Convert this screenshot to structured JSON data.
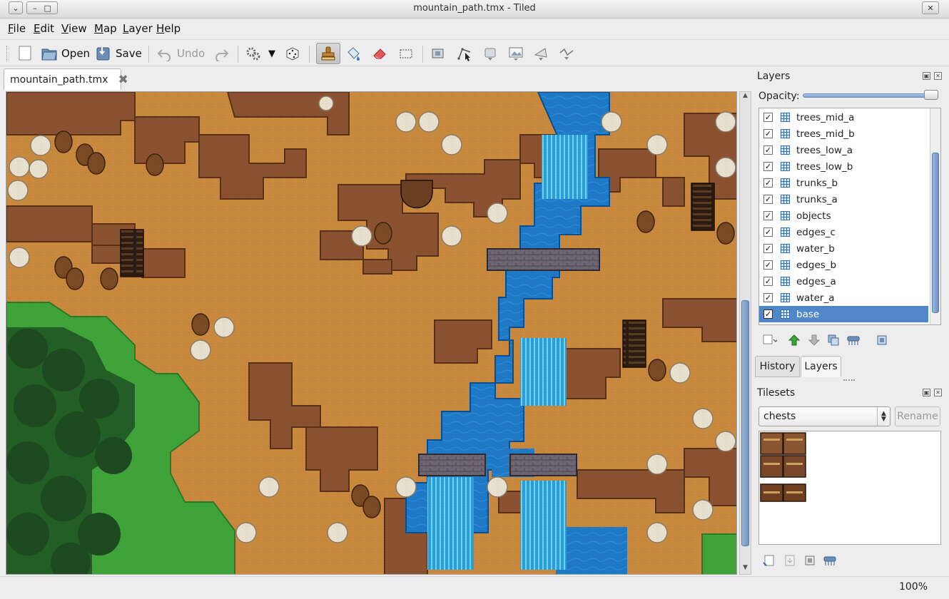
{
  "window": {
    "title": "mountain_path.tmx - Tiled",
    "menu_icon": "chevron-down-icon",
    "minimize_icon": "minimize-icon",
    "maximize_icon": "maximize-icon",
    "close_icon": "close-icon"
  },
  "menu": [
    {
      "key": "F",
      "rest": "ile"
    },
    {
      "key": "E",
      "rest": "dit"
    },
    {
      "key": "V",
      "rest": "iew"
    },
    {
      "key": "M",
      "rest": "ap"
    },
    {
      "key": "L",
      "rest": "ayer"
    },
    {
      "key": "H",
      "rest": "elp"
    }
  ],
  "toolbar": {
    "open_label": "Open",
    "save_label": "Save",
    "undo_label": "Undo"
  },
  "document_tab": {
    "label": "mountain_path.tmx",
    "close_icon": "close-icon"
  },
  "layers_panel": {
    "title": "Layers",
    "opacity_label": "Opacity:",
    "opacity": 1.0,
    "layers": [
      {
        "name": "trees_mid_a",
        "visible": true,
        "selected": false
      },
      {
        "name": "trees_mid_b",
        "visible": true,
        "selected": false
      },
      {
        "name": "trees_low_a",
        "visible": true,
        "selected": false
      },
      {
        "name": "trees_low_b",
        "visible": true,
        "selected": false
      },
      {
        "name": "trunks_b",
        "visible": true,
        "selected": false
      },
      {
        "name": "trunks_a",
        "visible": true,
        "selected": false
      },
      {
        "name": "objects",
        "visible": true,
        "selected": false
      },
      {
        "name": "edges_c",
        "visible": true,
        "selected": false
      },
      {
        "name": "water_b",
        "visible": true,
        "selected": false
      },
      {
        "name": "edges_b",
        "visible": true,
        "selected": false
      },
      {
        "name": "edges_a",
        "visible": true,
        "selected": false
      },
      {
        "name": "water_a",
        "visible": true,
        "selected": false
      },
      {
        "name": "base",
        "visible": true,
        "selected": true
      }
    ]
  },
  "panel_tabs": {
    "history_label": "History",
    "layers_label": "Layers",
    "active": "Layers"
  },
  "tilesets_panel": {
    "title": "Tilesets",
    "selected_tileset": "chests",
    "rename_label": "Rename"
  },
  "status": {
    "zoom": "100%"
  },
  "colors": {
    "dirt": "#c8883e",
    "cliff": "#8a5230",
    "water": "#1f79c4",
    "grass": "#3fa33a",
    "selection": "#4f87c9"
  }
}
